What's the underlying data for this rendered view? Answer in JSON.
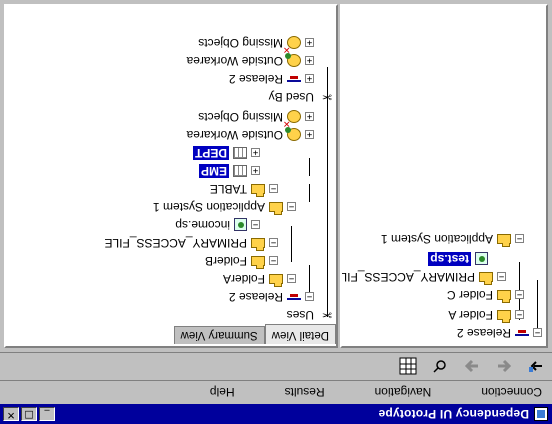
{
  "window": {
    "title": "Dependency UI Prototype",
    "controls": {
      "minimize": "_",
      "maximize": "□",
      "close": "✕"
    }
  },
  "menu": [
    "Connection",
    "Navigation",
    "Results",
    "Help"
  ],
  "toolbar": [
    "connect-icon",
    "back-icon",
    "forward-icon",
    "inspect-icon",
    "grid-icon"
  ],
  "tabs": {
    "detail": "Detail View",
    "summary": "Summary View"
  },
  "right_tree": [
    {
      "label": "Release 2",
      "icon": "release-icon"
    },
    {
      "label": "Folder A",
      "icon": "folder-icon"
    },
    {
      "label": "Folder C",
      "icon": "folder-icon"
    },
    {
      "label": "PRIMARY_ACCESS_FILE",
      "icon": "folder-icon"
    },
    {
      "label": "test.sp",
      "icon": "file-icon"
    },
    {
      "label": "Application System 1",
      "icon": "folder-icon"
    }
  ],
  "left_tree": [
    {
      "label": "Uses",
      "icon": "scissor-icon"
    },
    {
      "label": "Release 2",
      "icon": "release-icon"
    },
    {
      "label": "FolderA",
      "icon": "folder-icon"
    },
    {
      "label": "FolderB",
      "icon": "folder-icon"
    },
    {
      "label": "PRIMARY_ACCESS_FILE",
      "icon": "folder-icon"
    },
    {
      "label": "income.sp",
      "icon": "file-icon"
    },
    {
      "label": "Application System 1",
      "icon": "folder-icon"
    },
    {
      "label": "TABLE",
      "icon": "folder-icon"
    },
    {
      "label": "EMP",
      "icon": "table-icon"
    },
    {
      "label": "DEPT",
      "icon": "table-icon"
    },
    {
      "label": "Outside Workarea",
      "icon": "warning-green-icon"
    },
    {
      "label": "Missing Objects",
      "icon": "warning-red-icon"
    },
    {
      "label": "Used By",
      "icon": "scissor-icon"
    },
    {
      "label": "Release 2",
      "icon": "release-icon"
    },
    {
      "label": "Outside Workarea",
      "icon": "warning-green-icon"
    },
    {
      "label": "Missing Objects",
      "icon": "warning-red-icon"
    }
  ]
}
